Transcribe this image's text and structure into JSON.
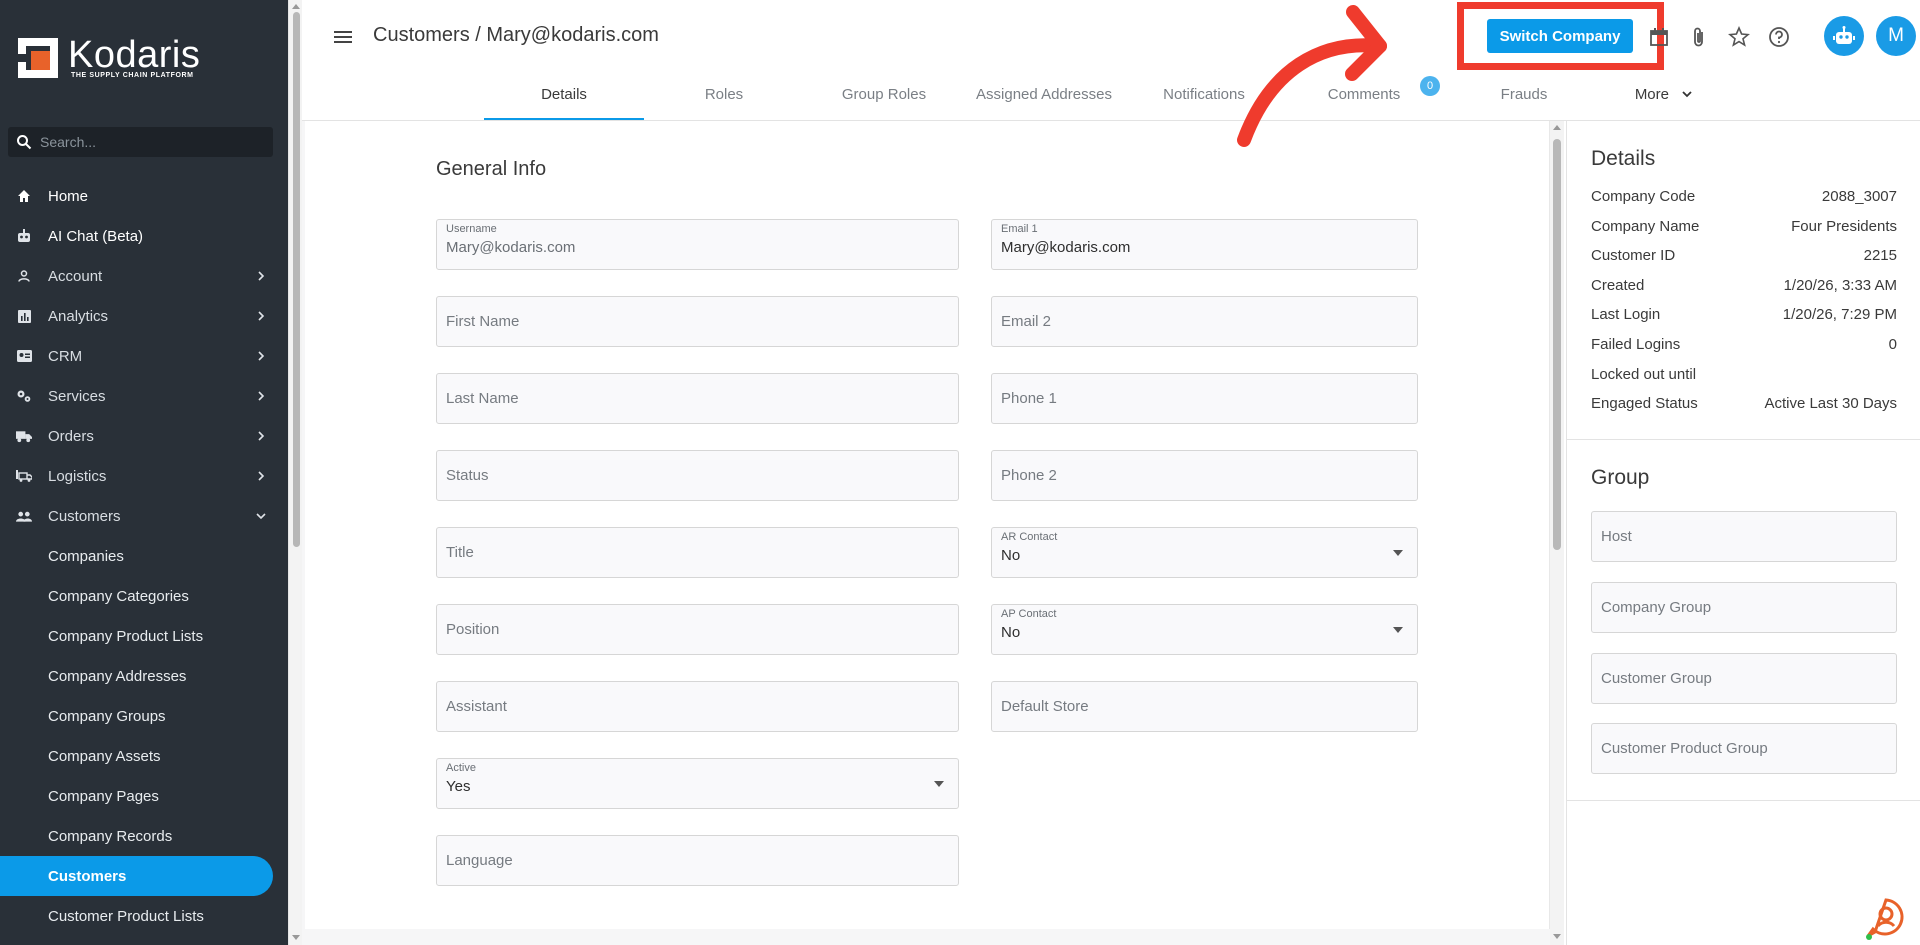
{
  "sidebar": {
    "logo_text": "Kodaris",
    "logo_tagline": "THE SUPPLY CHAIN PLATFORM",
    "search_placeholder": "Search...",
    "items": [
      {
        "label": "Home",
        "icon": "home-icon"
      },
      {
        "label": "AI Chat (Beta)",
        "icon": "robot-icon"
      },
      {
        "label": "Account",
        "icon": "person-icon"
      },
      {
        "label": "Analytics",
        "icon": "analytics-icon"
      },
      {
        "label": "CRM",
        "icon": "contact-card-icon"
      },
      {
        "label": "Services",
        "icon": "gears-icon"
      },
      {
        "label": "Orders",
        "icon": "truck-icon"
      },
      {
        "label": "Logistics",
        "icon": "shipping-icon"
      },
      {
        "label": "Customers",
        "icon": "people-icon"
      }
    ],
    "sub_items": [
      "Companies",
      "Company Categories",
      "Company Product Lists",
      "Company Addresses",
      "Company Groups",
      "Company Assets",
      "Company Pages",
      "Company Records",
      "Customers",
      "Customer Product Lists"
    ]
  },
  "header": {
    "breadcrumb": "Customers / Mary@kodaris.com",
    "switch_company": "Switch Company",
    "avatar_initial": "M"
  },
  "tabs": [
    "Details",
    "Roles",
    "Group Roles",
    "Assigned Addresses",
    "Notifications",
    "Comments",
    "Frauds"
  ],
  "tab_more": "More",
  "comments_badge": "0",
  "general_info": {
    "title": "General Info",
    "left_fields": [
      {
        "label": "Username",
        "value": "Mary@kodaris.com"
      },
      {
        "placeholder": "First Name"
      },
      {
        "placeholder": "Last Name"
      },
      {
        "placeholder": "Status"
      },
      {
        "placeholder": "Title"
      },
      {
        "placeholder": "Position"
      },
      {
        "placeholder": "Assistant"
      },
      {
        "label": "Active",
        "value": "Yes"
      },
      {
        "placeholder": "Language"
      }
    ],
    "right_fields": [
      {
        "label": "Email 1",
        "value": "Mary@kodaris.com"
      },
      {
        "placeholder": "Email 2"
      },
      {
        "placeholder": "Phone 1"
      },
      {
        "placeholder": "Phone 2"
      },
      {
        "label": "AR Contact",
        "value": "No"
      },
      {
        "label": "AP Contact",
        "value": "No"
      },
      {
        "placeholder": "Default Store"
      }
    ]
  },
  "details": {
    "title": "Details",
    "rows": [
      {
        "label": "Company Code",
        "value": "2088_3007"
      },
      {
        "label": "Company Name",
        "value": "Four Presidents"
      },
      {
        "label": "Customer ID",
        "value": "2215"
      },
      {
        "label": "Created",
        "value": "1/20/26, 3:33 AM"
      },
      {
        "label": "Last Login",
        "value": "1/20/26, 7:29 PM"
      },
      {
        "label": "Failed Logins",
        "value": "0"
      },
      {
        "label": "Locked out until",
        "value": ""
      },
      {
        "label": "Engaged Status",
        "value": "Active Last 30 Days"
      }
    ]
  },
  "group": {
    "title": "Group",
    "fields": [
      "Host",
      "Company Group",
      "Customer Group",
      "Customer Product Group"
    ]
  },
  "colors": {
    "accent": "#0b9ae8",
    "sidebar_bg": "#293038",
    "highlight": "#ef3b2d"
  }
}
